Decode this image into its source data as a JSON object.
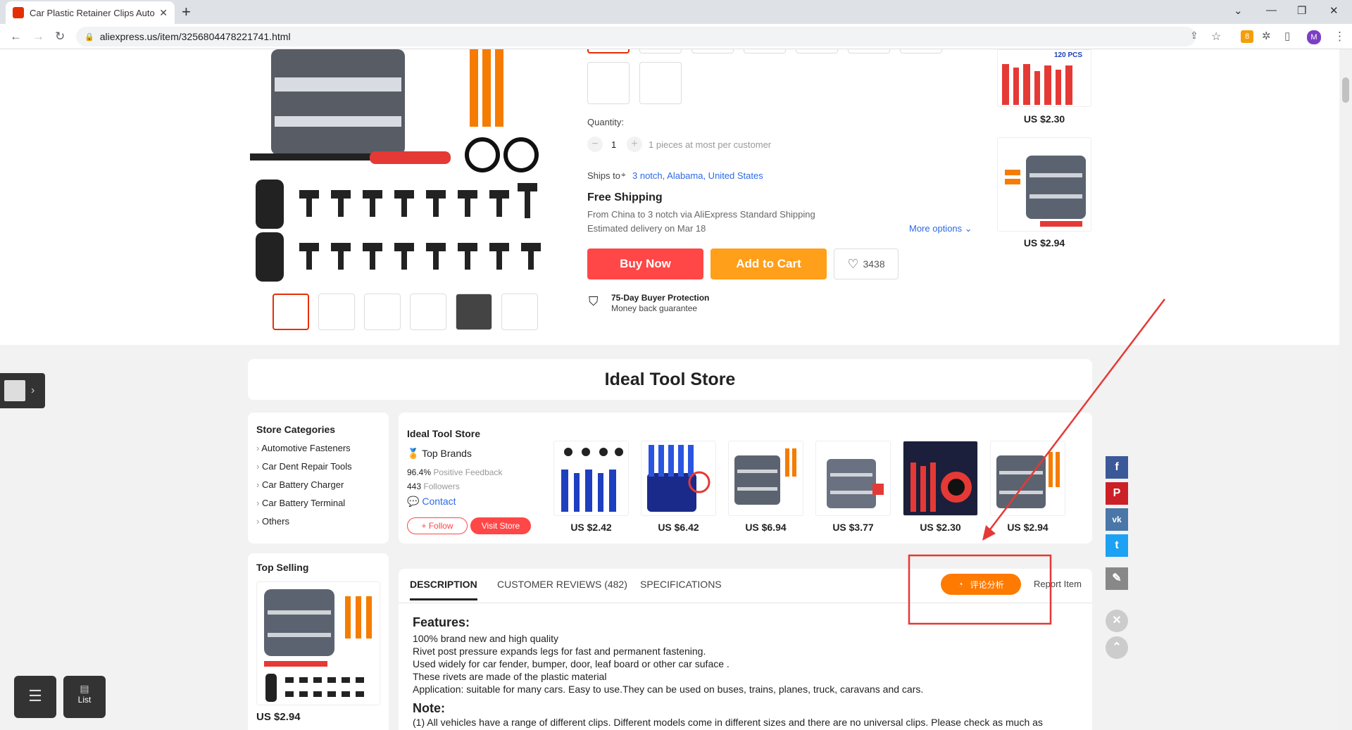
{
  "browser": {
    "tab_title": "Car Plastic Retainer Clips Auto",
    "url": "aliexpress.us/item/3256804478221741.html"
  },
  "product": {
    "quantity_label": "Quantity:",
    "quantity": "1",
    "quantity_note": "1 pieces at most per customer",
    "ships_to_label": "Ships to",
    "ships_to": "3 notch, Alabama, United States",
    "shipping_title": "Free Shipping",
    "shipping_from": "From China to 3 notch via AliExpress Standard Shipping",
    "delivery": "Estimated delivery on Mar 18",
    "more_options": "More options",
    "buy_now": "Buy Now",
    "add_to_cart": "Add to Cart",
    "wishlist_count": "3438",
    "protection_title": "75-Day Buyer Protection",
    "protection_sub": "Money back guarantee"
  },
  "side_prices": [
    "US $2.30",
    "US $2.94"
  ],
  "side_badge": "120 PCS",
  "store": {
    "name": "Ideal Tool Store",
    "title": "Ideal Tool Store",
    "badge": "Top Brands",
    "feedback_value": "96.4%",
    "feedback_label": "Positive Feedback",
    "followers_value": "443",
    "followers_label": "Followers",
    "contact": "Contact",
    "follow": "+ Follow",
    "visit": "Visit Store"
  },
  "categories": {
    "title": "Store Categories",
    "items": [
      "Automotive Fasteners",
      "Car Dent Repair Tools",
      "Car Battery Charger",
      "Car Battery Terminal",
      "Others"
    ]
  },
  "store_products": [
    "US $2.42",
    "US $6.42",
    "US $6.94",
    "US $3.77",
    "US $2.30",
    "US $2.94"
  ],
  "top_selling": {
    "title": "Top Selling",
    "price": "US $2.94"
  },
  "tabs": {
    "description": "DESCRIPTION",
    "reviews": "CUSTOMER REVIEWS (482)",
    "specs": "SPECIFICATIONS",
    "analysis": "评论分析",
    "report": "Report Item"
  },
  "description": {
    "features_title": "Features:",
    "lines": [
      "100% brand new and high quality",
      "Rivet post pressure expands legs for fast and permanent fastening.",
      "Used widely for car fender, bumper, door, leaf board or other car suface .",
      "These rivets are made of the plastic material",
      "Application: suitable for many cars. Easy to use.They can be used on buses, trains, planes, truck, caravans and cars."
    ],
    "note_title": "Note:",
    "note_line": "(1) All vehicles have a range of different clips. Different models come in different sizes and there are no universal clips. Please check as much as"
  },
  "floating": {
    "list_label": "List"
  },
  "colors": {
    "accent": "#ff4747",
    "orange": "#ff9f1a",
    "annotation": "#e53935"
  }
}
